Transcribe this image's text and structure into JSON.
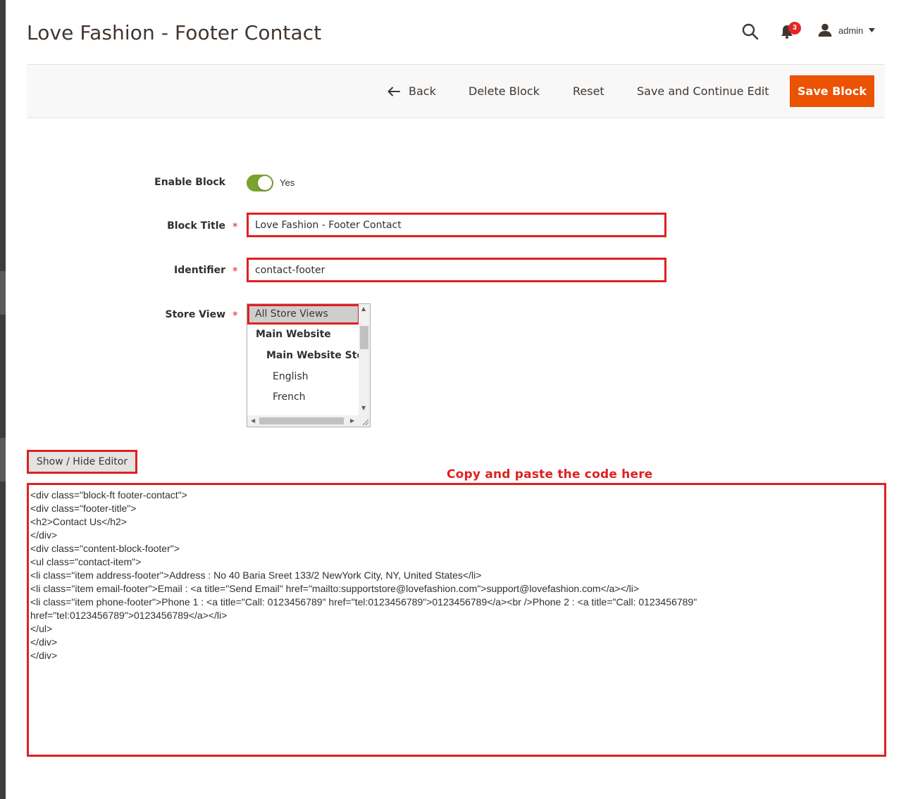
{
  "header": {
    "title": "Love Fashion - Footer Contact",
    "notifications_count": "3",
    "user_name": "admin"
  },
  "actions": {
    "back": "Back",
    "delete": "Delete Block",
    "reset": "Reset",
    "save_continue": "Save and Continue Edit",
    "save": "Save Block"
  },
  "form": {
    "enable_label": "Enable Block",
    "enable_value": "Yes",
    "title_label": "Block Title",
    "title_value": "Love Fashion - Footer Contact",
    "identifier_label": "Identifier",
    "identifier_value": "contact-footer",
    "store_label": "Store View",
    "store_options": [
      "All Store Views",
      "Main Website",
      "Main Website Store",
      "English",
      "French"
    ],
    "required_mark": "*"
  },
  "editor": {
    "toggle_label": "Show / Hide Editor",
    "annotation": "Copy and paste the code here",
    "content": "<div class=\"block-ft footer-contact\">\n<div class=\"footer-title\">\n<h2>Contact Us</h2>\n</div>\n<div class=\"content-block-footer\">\n<ul class=\"contact-item\">\n<li class=\"item address-footer\">Address : No 40 Baria Sreet 133/2 NewYork City, NY, United States</li>\n<li class=\"item email-footer\">Email : <a title=\"Send Email\" href=\"mailto:supportstore@lovefashion.com\">support@lovefashion.com</a></li>\n<li class=\"item phone-footer\">Phone 1 : <a title=\"Call: 0123456789\" href=\"tel:0123456789\">0123456789</a><br />Phone 2 : <a title=\"Call: 0123456789\"\nhref=\"tel:0123456789\">0123456789</a></li>\n</ul>\n</div>\n</div>"
  },
  "colors": {
    "accent": "#eb5202",
    "toggle_on": "#79a22e",
    "annotation_red": "#e02020",
    "badge": "#e22626"
  },
  "icons": [
    "search-icon",
    "bell-icon",
    "user-icon",
    "caret-down-icon",
    "arrow-left-icon"
  ]
}
